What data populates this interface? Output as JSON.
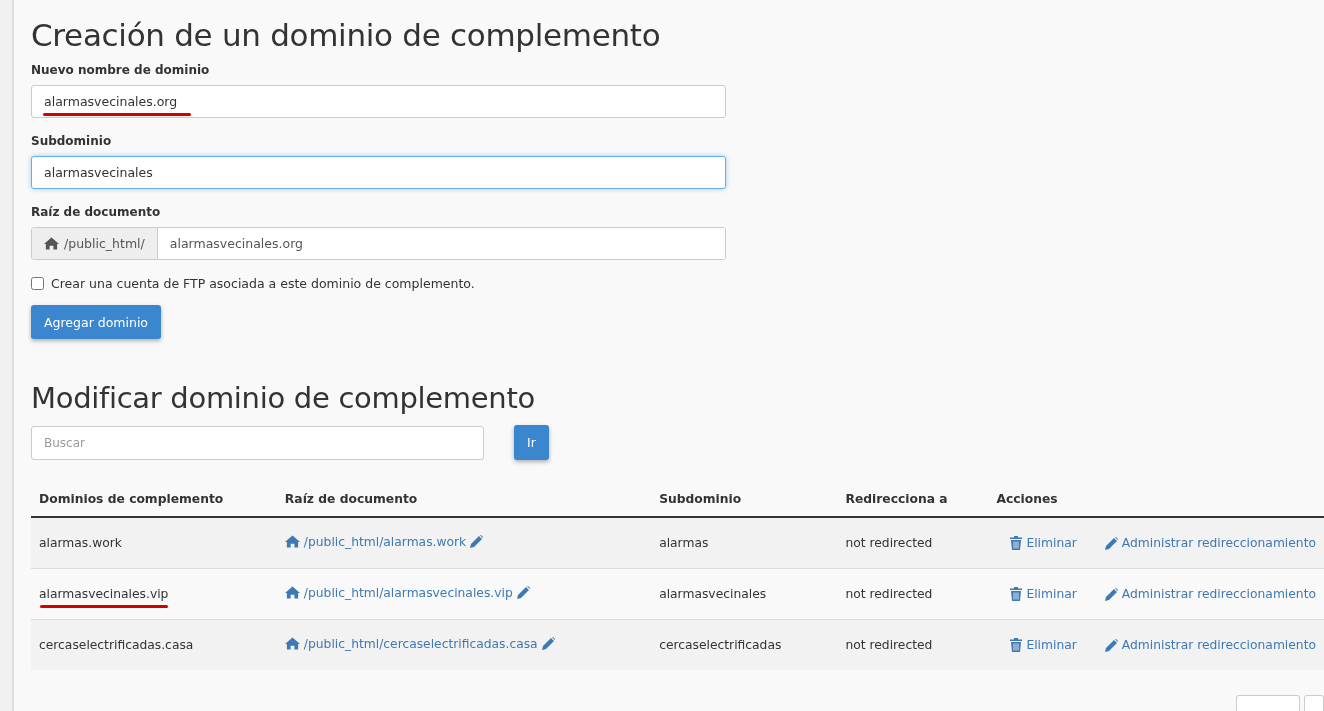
{
  "create_form": {
    "title": "Creación de un dominio de complemento",
    "fields": [
      {
        "kind": "text",
        "label": "Nuevo nombre de dominio",
        "value": "alarmasvecinales.org",
        "focused": false,
        "marked": true
      },
      {
        "kind": "text",
        "label": "Subdominio",
        "value": "alarmasvecinales",
        "focused": true,
        "marked": false
      },
      {
        "kind": "prefixed",
        "label": "Raíz de documento",
        "prefix": "/public_html/",
        "value": "alarmasvecinales.org",
        "focused": false,
        "marked": false
      }
    ],
    "ftp_checkbox": {
      "label": "Crear una cuenta de FTP asociada a este dominio de complemento.",
      "checked": false
    },
    "submit_button": "Agregar dominio"
  },
  "modify": {
    "title": "Modificar dominio de complemento",
    "search": {
      "placeholder": "Buscar"
    },
    "go_button": "Ir",
    "table": {
      "columns": [
        "Dominios de complemento",
        "Raíz de documento",
        "Subdominio",
        "Redirecciona a",
        "Acciones"
      ],
      "rows": [
        {
          "domain": "alarmas.work",
          "marked": false,
          "document_root": "/public_html/alarmas.work",
          "subdomain": "alarmas",
          "redirects_to": "not redirected",
          "actions": [
            "Eliminar",
            "Administrar redireccionamiento"
          ]
        },
        {
          "domain": "alarmasvecinales.vip",
          "marked": true,
          "document_root": "/public_html/alarmasvecinales.vip",
          "subdomain": "alarmasvecinales",
          "redirects_to": "not redirected",
          "actions": [
            "Eliminar",
            "Administrar redireccionamiento"
          ]
        },
        {
          "domain": "cercaselectrificadas.casa",
          "marked": false,
          "document_root": "/public_html/cercaselectrificadas.casa",
          "subdomain": "cercaselectrificadas",
          "redirects_to": "not redirected",
          "actions": [
            "Eliminar",
            "Administrar redireccionamiento"
          ]
        }
      ]
    }
  }
}
